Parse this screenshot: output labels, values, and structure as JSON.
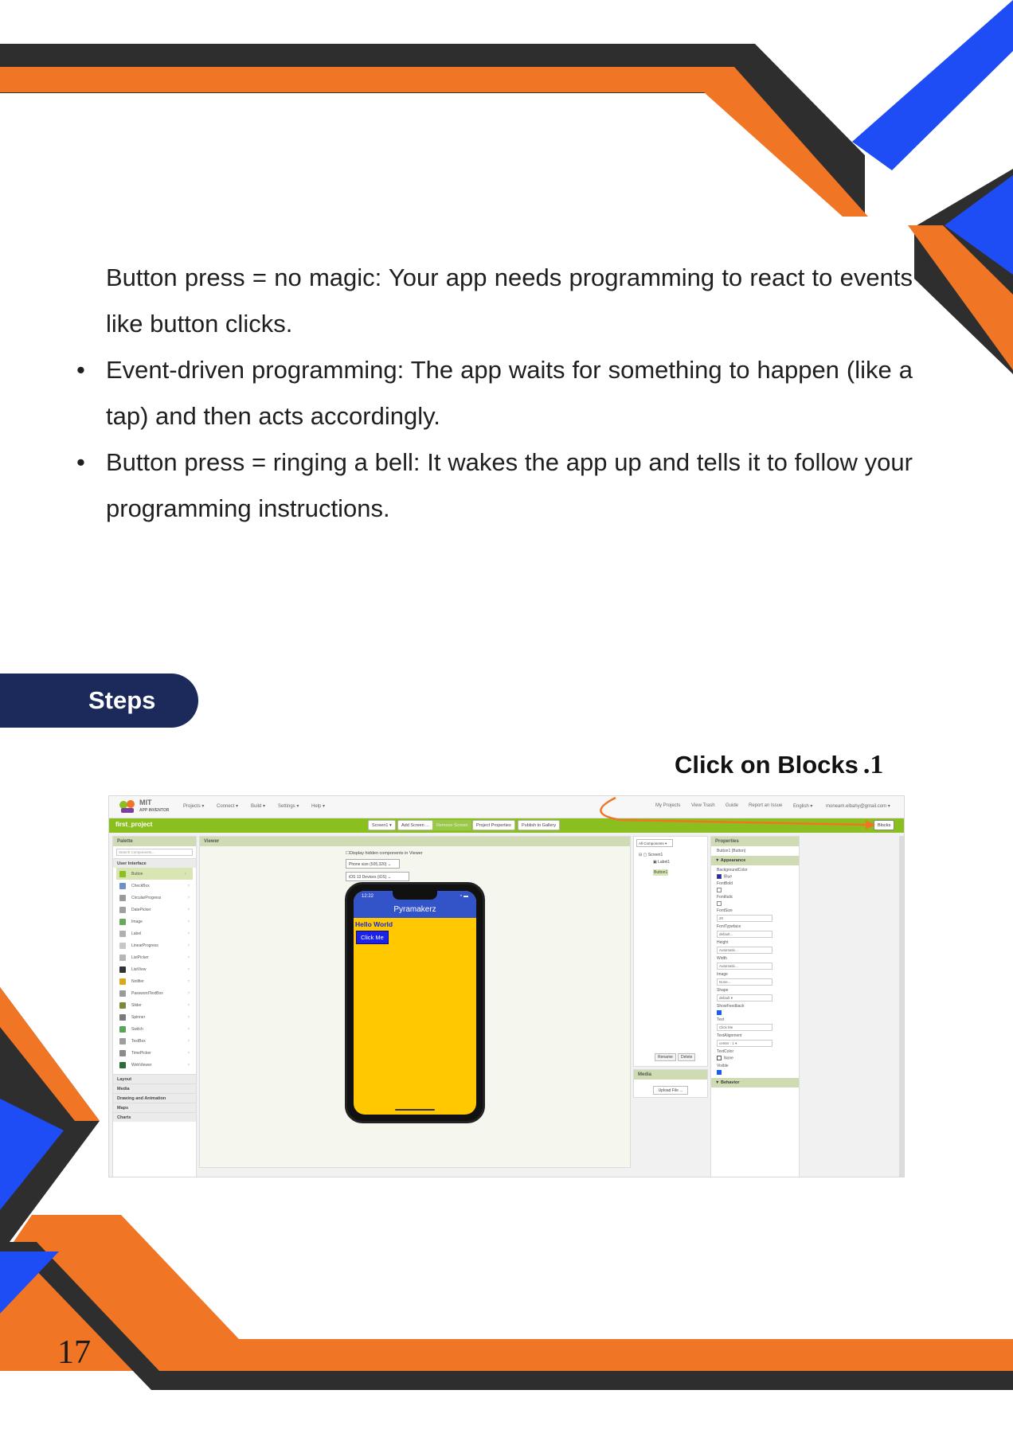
{
  "colors": {
    "orange": "#f07525",
    "dark": "#2e2e2e",
    "blue": "#1f4df5",
    "navy": "#1b2a5b",
    "ai_green": "#8bbf1f"
  },
  "body": {
    "paragraphs": [
      {
        "bullet": "",
        "text": "Button press = no magic: Your app needs programming to react to events like button clicks."
      },
      {
        "bullet": "•",
        "text": "Event-driven programming: The app waits for something to happen (like a tap) and then acts accordingly."
      },
      {
        "bullet": "•",
        "text": "Button press = ringing a bell: It wakes the app up and tells it to follow your programming instructions."
      }
    ]
  },
  "steps_label": "Steps",
  "callout": {
    "text": "Click on Blocks",
    "number": ".1"
  },
  "page_number": "17",
  "screenshot": {
    "logo": {
      "line1": "MIT",
      "line2": "APP INVENTOR"
    },
    "menu": [
      "Projects ▾",
      "Connect ▾",
      "Build ▾",
      "Settings ▾",
      "Help ▾"
    ],
    "menu_right": [
      "My Projects",
      "View Trash",
      "Guide",
      "Report an Issue",
      "English ▾",
      "moneam.elbahy@gmail.com ▾"
    ],
    "project_name": "first_project",
    "toolbar": [
      "Screen1 ▾",
      "Add Screen ...",
      "Remove Screen",
      "Project Properties",
      "Publish to Gallery"
    ],
    "blocks_button": "Blocks",
    "palette": {
      "header": "Palette",
      "search_placeholder": "Search Components...",
      "category": "User Interface",
      "items": [
        "Button",
        "CheckBox",
        "CircularProgress",
        "DatePicker",
        "Image",
        "Label",
        "LinearProgress",
        "ListPicker",
        "ListView",
        "Notifier",
        "PasswordTextBox",
        "Slider",
        "Spinner",
        "Switch",
        "TextBox",
        "TimePicker",
        "WebViewer"
      ],
      "other_categories": [
        "Layout",
        "Media",
        "Drawing and Animation",
        "Maps",
        "Charts"
      ]
    },
    "viewer": {
      "header": "Viewer",
      "checkbox_label": "Display hidden components in Viewer",
      "size_select": "Phone size (505,320)",
      "device_select": "iOS 13 Devices (iOS)",
      "status_time": "12:22",
      "app_title": "Pyramakerz",
      "label_text": "Hello World",
      "button_text": "Click Me"
    },
    "components": {
      "selector": "All Components ▾",
      "tree": [
        "Screen1",
        "Label1",
        "Button1"
      ],
      "rename": "Rename",
      "delete": "Delete",
      "media_header": "Media",
      "upload": "Upload File ..."
    },
    "properties": {
      "header": "Properties",
      "subtitle": "Button1 (Button)",
      "section": "▼ Appearance",
      "behavior_section": "▼ Behavior",
      "rows": [
        {
          "name": "BackgroundColor",
          "value": "Blue",
          "kind": "swatch"
        },
        {
          "name": "FontBold",
          "value": "",
          "kind": "check"
        },
        {
          "name": "FontItalic",
          "value": "",
          "kind": "check"
        },
        {
          "name": "FontSize",
          "value": "20",
          "kind": "input"
        },
        {
          "name": "FontTypeface",
          "value": "default...",
          "kind": "input"
        },
        {
          "name": "Height",
          "value": "Automatic...",
          "kind": "input"
        },
        {
          "name": "Width",
          "value": "Automatic...",
          "kind": "input"
        },
        {
          "name": "Image",
          "value": "None...",
          "kind": "input"
        },
        {
          "name": "Shape",
          "value": "default ▾",
          "kind": "input"
        },
        {
          "name": "ShowFeedback",
          "value": "",
          "kind": "check-on"
        },
        {
          "name": "Text",
          "value": "Click Me",
          "kind": "input"
        },
        {
          "name": "TextAlignment",
          "value": "center : 1 ▾",
          "kind": "input"
        },
        {
          "name": "TextColor",
          "value": "None",
          "kind": "swatch-white"
        },
        {
          "name": "Visible",
          "value": "",
          "kind": "check-on"
        }
      ]
    }
  }
}
